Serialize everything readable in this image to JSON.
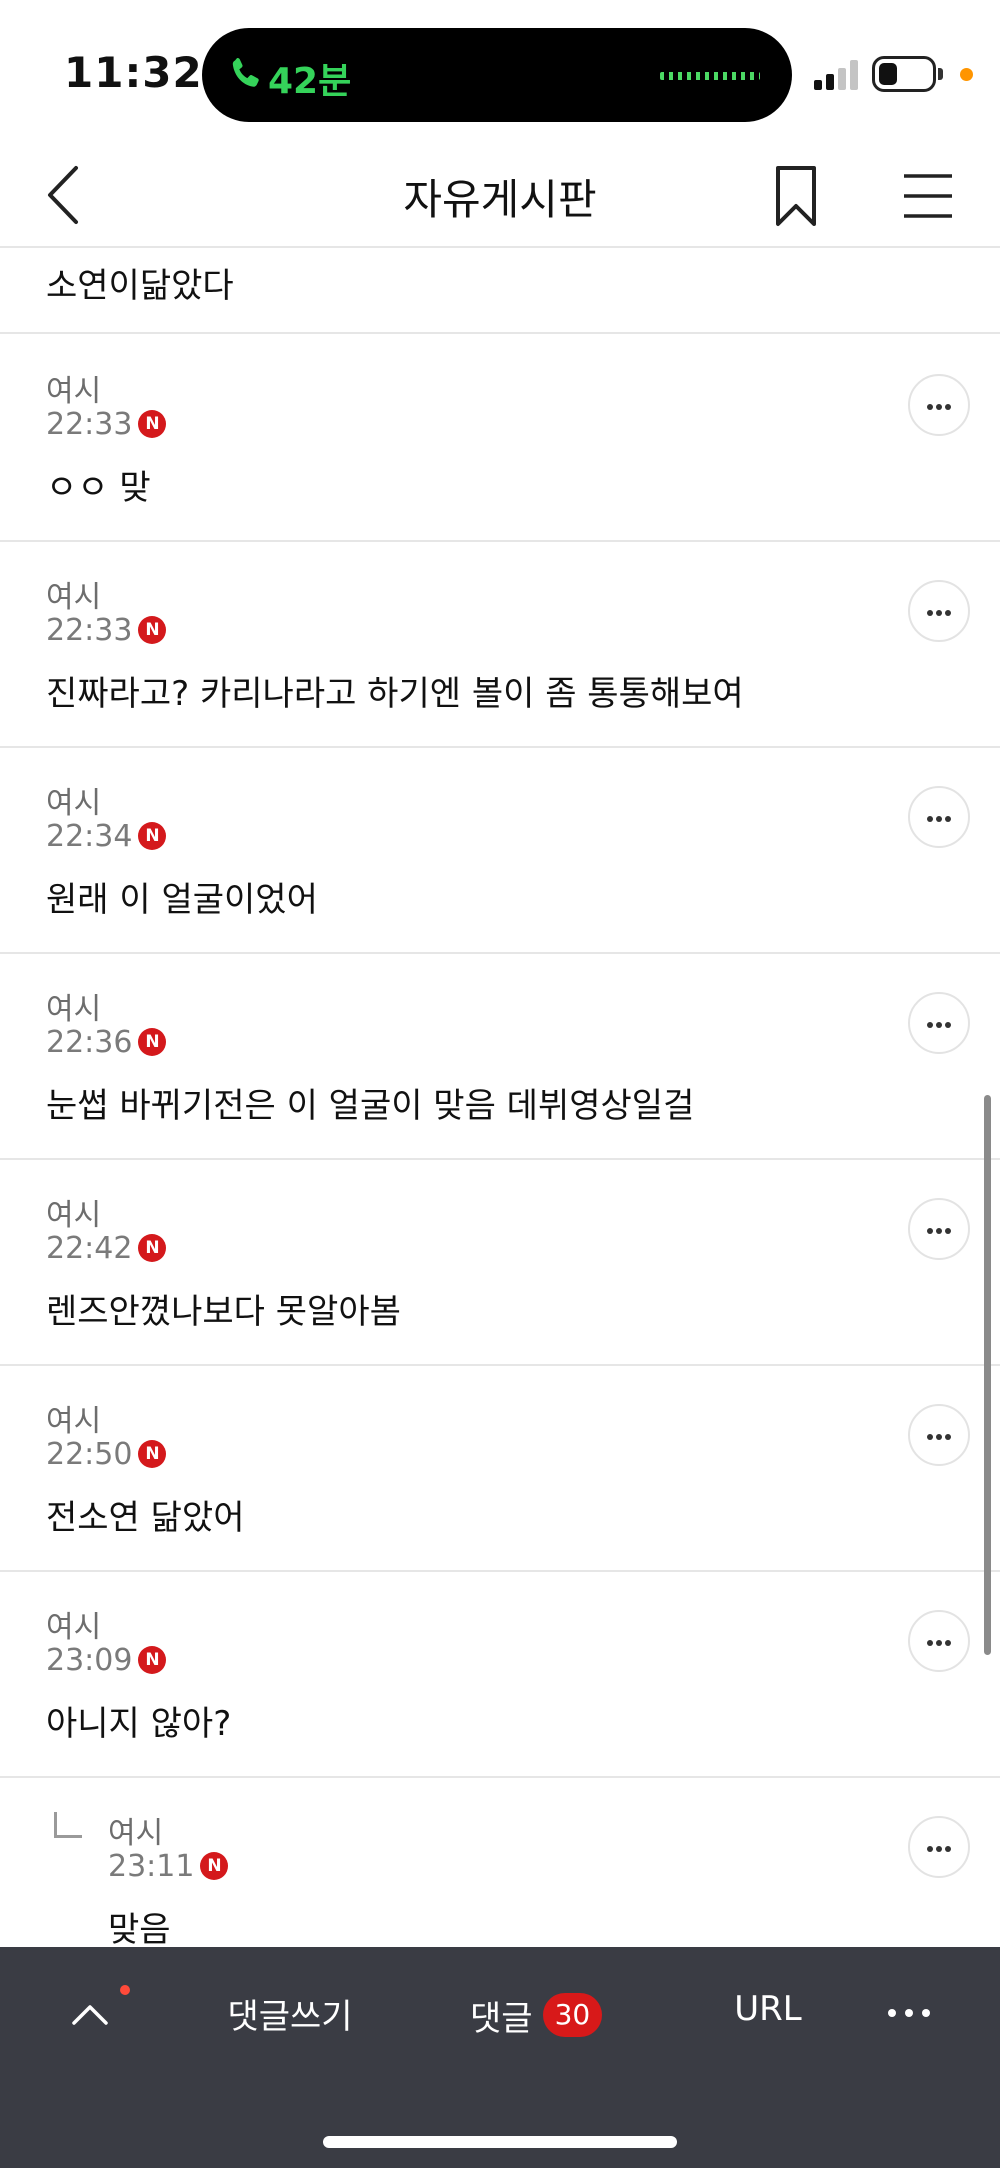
{
  "status_bar": {
    "time": "11:32",
    "call_duration": "42분",
    "colors": {
      "call_green": "#35d35a",
      "privacy_dot": "#ff9500"
    }
  },
  "nav": {
    "title": "자유게시판",
    "icons": [
      "back-chevron-icon",
      "bookmark-icon",
      "hamburger-menu-icon"
    ]
  },
  "comments": {
    "partial_top": {
      "body": "소연이닮았다"
    },
    "badge_label": "N",
    "items": [
      {
        "author": "여시",
        "time": "22:33",
        "body": "ㅇㅇ 맞"
      },
      {
        "author": "여시",
        "time": "22:33",
        "body": "진짜라고? 카리나라고 하기엔 볼이 좀 통통해보여"
      },
      {
        "author": "여시",
        "time": "22:34",
        "body": "원래 이 얼굴이었어"
      },
      {
        "author": "여시",
        "time": "22:36",
        "body": "눈썹 바뀌기전은 이 얼굴이 맞음 데뷔영상일걸"
      },
      {
        "author": "여시",
        "time": "22:42",
        "body": "렌즈안꼈나보다 못알아봄"
      },
      {
        "author": "여시",
        "time": "22:50",
        "body": "전소연 닮았어"
      },
      {
        "author": "여시",
        "time": "23:09",
        "body": "아니지 않아?"
      }
    ],
    "reply": {
      "author": "여시",
      "time": "23:11",
      "body": "맞음"
    }
  },
  "bottom_bar": {
    "write_label": "댓글쓰기",
    "comments_label": "댓글",
    "comments_count": "30",
    "url_label": "URL",
    "colors": {
      "background": "#3a3c44",
      "badge": "#d81919"
    }
  }
}
